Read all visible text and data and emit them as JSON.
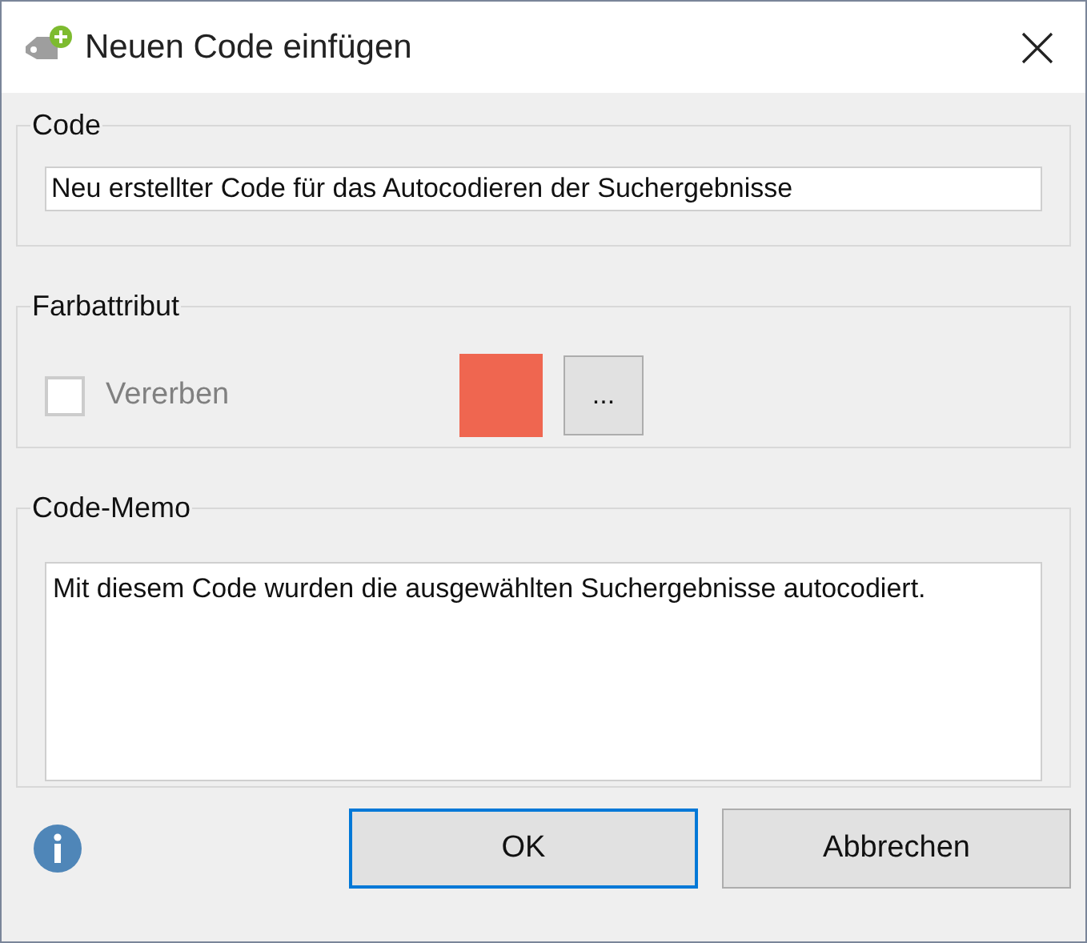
{
  "window": {
    "title": "Neuen Code einfügen"
  },
  "code_group": {
    "label": "Code",
    "value": "Neu erstellter Code für das Autocodieren der Suchergebnisse"
  },
  "color_group": {
    "label": "Farbattribut",
    "inherit": {
      "label": "Vererben",
      "checked": false,
      "disabled": true
    },
    "color": "#ef6650",
    "more_button": "..."
  },
  "memo_group": {
    "label": "Code-Memo",
    "value": "Mit diesem Code wurden die ausgewählten Suchergebnisse autocodiert."
  },
  "buttons": [
    {
      "label": "OK",
      "default": true
    },
    {
      "label": "Abbrechen",
      "default": false
    }
  ]
}
